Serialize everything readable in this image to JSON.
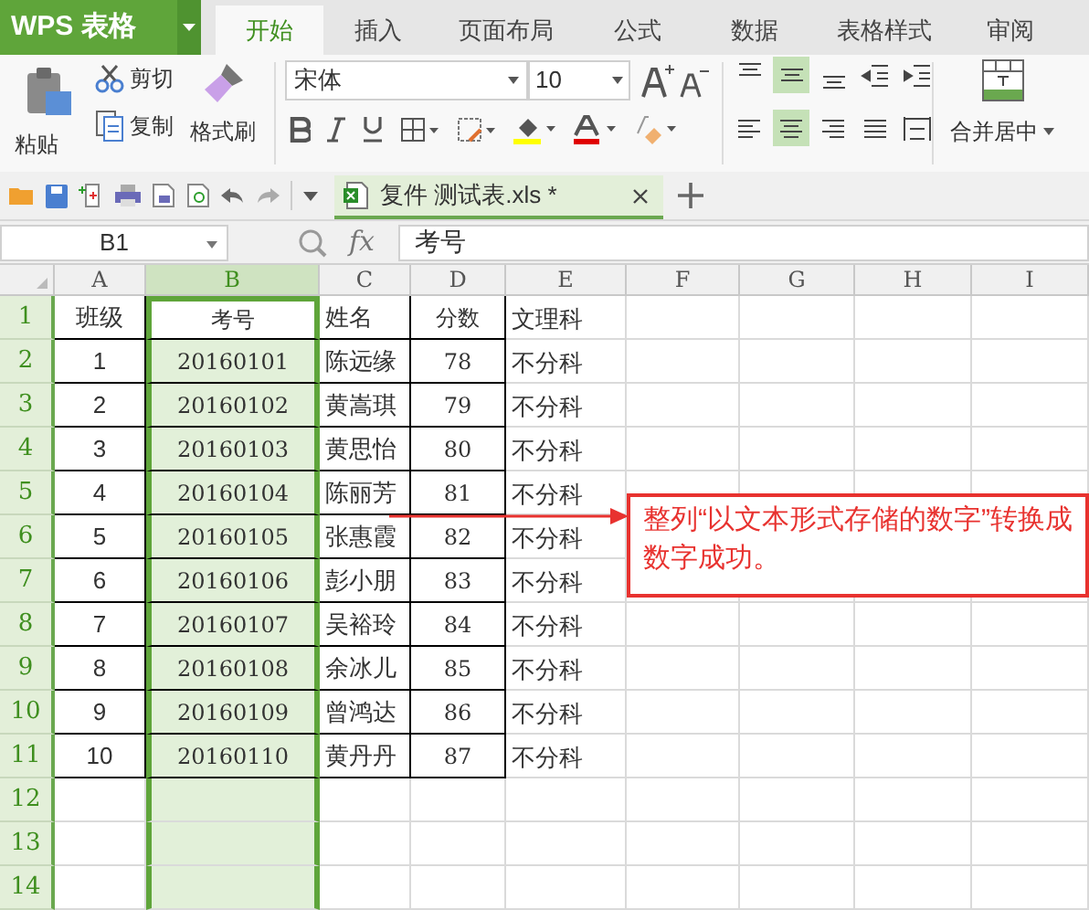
{
  "app": {
    "logo": "WPS 表格"
  },
  "tabs": [
    {
      "label": "开始",
      "selected": true
    },
    {
      "label": "插入",
      "selected": false
    },
    {
      "label": "页面布局",
      "selected": false
    },
    {
      "label": "公式",
      "selected": false
    },
    {
      "label": "数据",
      "selected": false
    },
    {
      "label": "表格样式",
      "selected": false
    },
    {
      "label": "审阅",
      "selected": false
    }
  ],
  "ribbon": {
    "paste": "粘贴",
    "cut": "剪切",
    "copy": "复制",
    "format_painter": "格式刷",
    "font_name": "宋体",
    "font_size": "10",
    "align_top_row": [
      {
        "kind": "top",
        "selected": false
      },
      {
        "kind": "middle",
        "selected": true
      },
      {
        "kind": "bottom",
        "selected": false
      },
      {
        "kind": "outdent",
        "selected": false
      },
      {
        "kind": "indent",
        "selected": false
      }
    ],
    "align_bottom_row": [
      {
        "kind": "left",
        "selected": false
      },
      {
        "kind": "center",
        "selected": true
      },
      {
        "kind": "right",
        "selected": false
      },
      {
        "kind": "justify",
        "selected": false
      },
      {
        "kind": "distributed",
        "selected": false
      }
    ],
    "merge": "合并居中"
  },
  "document_tab": {
    "title": "复件 测试表.xls *"
  },
  "formula_bar": {
    "cell_ref": "B1",
    "fx": "fx",
    "value": "考号"
  },
  "columns": [
    {
      "label": "A",
      "selected": false
    },
    {
      "label": "B",
      "selected": true
    },
    {
      "label": "C",
      "selected": false
    },
    {
      "label": "D",
      "selected": false
    },
    {
      "label": "E",
      "selected": false
    },
    {
      "label": "F",
      "selected": false
    },
    {
      "label": "G",
      "selected": false
    },
    {
      "label": "H",
      "selected": false
    },
    {
      "label": "I",
      "selected": false
    }
  ],
  "rows": [
    {
      "label": "1",
      "active": true,
      "cells": [
        "班级",
        "考号",
        "姓名",
        "分数",
        "文理科"
      ]
    },
    {
      "label": "2",
      "active": false,
      "cells": [
        "1",
        "20160101",
        "陈远缘",
        "78",
        "不分科"
      ]
    },
    {
      "label": "3",
      "active": false,
      "cells": [
        "2",
        "20160102",
        "黄嵩琪",
        "79",
        "不分科"
      ]
    },
    {
      "label": "4",
      "active": false,
      "cells": [
        "3",
        "20160103",
        "黄思怡",
        "80",
        "不分科"
      ]
    },
    {
      "label": "5",
      "active": false,
      "cells": [
        "4",
        "20160104",
        "陈丽芳",
        "81",
        "不分科"
      ]
    },
    {
      "label": "6",
      "active": false,
      "cells": [
        "5",
        "20160105",
        "张惠霞",
        "82",
        "不分科"
      ]
    },
    {
      "label": "7",
      "active": false,
      "cells": [
        "6",
        "20160106",
        "彭小朋",
        "83",
        "不分科"
      ]
    },
    {
      "label": "8",
      "active": false,
      "cells": [
        "7",
        "20160107",
        "吴裕玲",
        "84",
        "不分科"
      ]
    },
    {
      "label": "9",
      "active": false,
      "cells": [
        "8",
        "20160108",
        "余冰儿",
        "85",
        "不分科"
      ]
    },
    {
      "label": "10",
      "active": false,
      "cells": [
        "9",
        "20160109",
        "曾鸿达",
        "86",
        "不分科"
      ]
    },
    {
      "label": "11",
      "active": false,
      "cells": [
        "10",
        "20160110",
        "黄丹丹",
        "87",
        "不分科"
      ]
    },
    {
      "label": "12",
      "active": false
    },
    {
      "label": "13",
      "active": false
    },
    {
      "label": "14",
      "active": false
    }
  ],
  "callout": {
    "text": "整列“以文本形式存储的数字”转换成数字成功。"
  }
}
